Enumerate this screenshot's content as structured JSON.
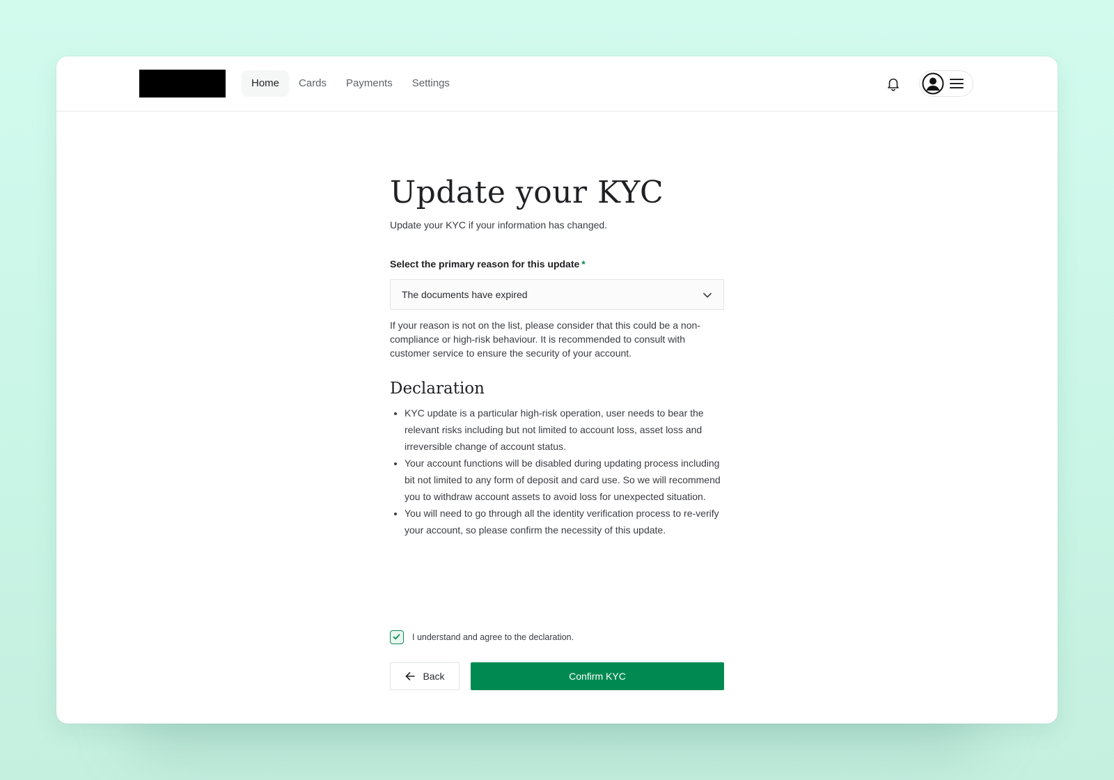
{
  "nav": {
    "items": [
      {
        "label": "Home",
        "active": true
      },
      {
        "label": "Cards",
        "active": false
      },
      {
        "label": "Payments",
        "active": false
      },
      {
        "label": "Settings",
        "active": false
      }
    ]
  },
  "header": {
    "icons": [
      "bell-icon",
      "user-avatar-icon",
      "menu-icon"
    ]
  },
  "page": {
    "title": "Update your KYC",
    "subtitle": "Update your KYC if your information has changed."
  },
  "form": {
    "reason_label": "Select the primary reason for this update",
    "required_mark": "*",
    "reason_value": "The documents have expired",
    "hint": "If your reason is not on the list, please consider that this could be a non-compliance or high-risk behaviour. It is recommended to consult with customer service to ensure the security of your account."
  },
  "declaration": {
    "title": "Declaration",
    "items": [
      "KYC update is a particular high-risk operation, user needs to bear the relevant risks including but not limited to account loss, asset loss and irreversible change of account status.",
      "Your account functions will be disabled during updating process including bit not limited to any form of deposit and card use. So we will recommend you to withdraw account assets to avoid loss for unexpected situation.",
      "You will need to go through all the identity verification process to re-verify your account, so please confirm the necessity of this update."
    ],
    "agree_label": "I understand and agree to the declaration.",
    "agree_checked": true
  },
  "actions": {
    "back_label": "Back",
    "confirm_label": "Confirm KYC"
  },
  "colors": {
    "accent": "#008a52",
    "background": "#d2fbee"
  }
}
